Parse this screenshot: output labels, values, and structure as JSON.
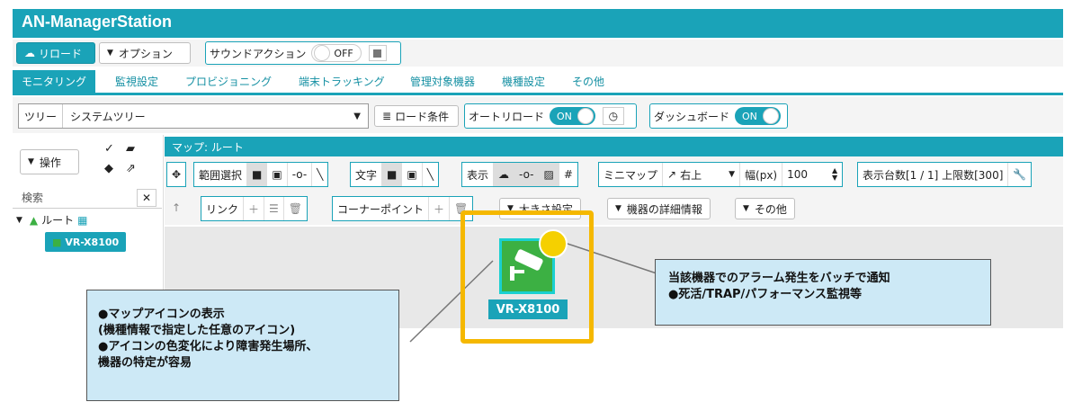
{
  "app": {
    "title": "AN-ManagerStation"
  },
  "toolbar": {
    "reload_label": "リロード",
    "options_label": "オプション",
    "sound_action_label": "サウンドアクション",
    "sound_toggle": "OFF"
  },
  "tabs": [
    {
      "label": "モニタリング"
    },
    {
      "label": "監視設定"
    },
    {
      "label": "プロビジョニング"
    },
    {
      "label": "端末トラッキング"
    },
    {
      "label": "管理対象機器"
    },
    {
      "label": "機種設定"
    },
    {
      "label": "その他"
    }
  ],
  "controls": {
    "tree_label": "ツリー",
    "tree_value": "システムツリー",
    "load_condition": "ロード条件",
    "auto_reload_label": "オートリロード",
    "auto_reload_toggle": "ON",
    "dashboard_label": "ダッシュボード",
    "dashboard_toggle": "ON"
  },
  "sidebar": {
    "operation_label": "操作",
    "search_placeholder": "検索",
    "root_label": "ルート",
    "device_label": "VR-X8100"
  },
  "map": {
    "header": "マップ: ルート",
    "range_select": "範囲選択",
    "text_label": "文字",
    "display_label": "表示",
    "minimap_label": "ミニマップ",
    "minimap_pos": "右上",
    "width_label": "幅(px)",
    "width_value": "100",
    "count_label": "表示台数[1 / 1] 上限数[300]",
    "link_label": "リンク",
    "corner_label": "コーナーポイント",
    "size_label": "大きさ設定",
    "device_detail_label": "機器の詳細情報",
    "other_label": "その他",
    "device_name": "VR-X8100"
  },
  "callouts": {
    "left": "●マップアイコンの表示\n(機種情報で指定した任意のアイコン)\n●アイコンの色変化により障害発生場所、\n機器の特定が容易",
    "right": "当該機器でのアラーム発生をバッチで通知\n●死活/TRAP/パフォーマンス監視等"
  },
  "colors": {
    "accent": "#1aa3b8",
    "highlight": "#f5b800",
    "device_green": "#3cb043",
    "callout_bg": "#cde9f6"
  }
}
